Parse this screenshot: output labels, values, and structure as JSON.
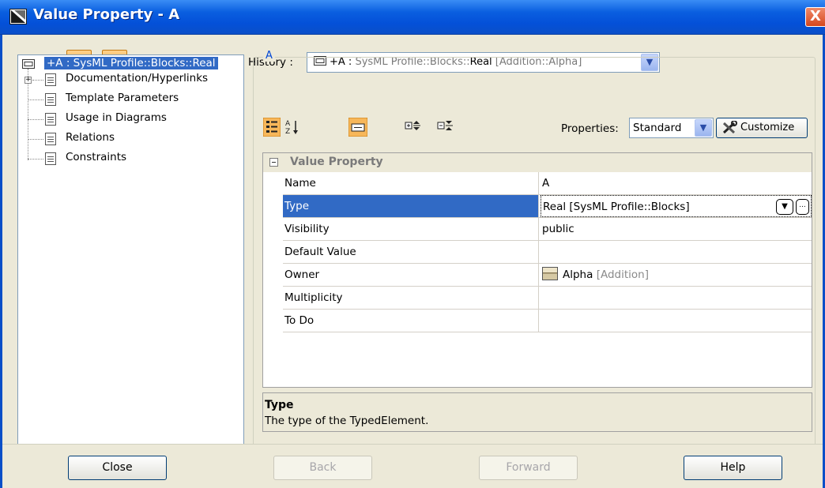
{
  "window": {
    "title": "Value Property - A",
    "close_glyph": "X"
  },
  "toolbar": {
    "history_label": "History :",
    "history_value_prefix": "+A : ",
    "history_value_path": "SysML Profile::Blocks::",
    "history_value_name": "Real",
    "history_value_ctx": " [Addition::Alpha]"
  },
  "tree": {
    "root_label": "+A : SysML Profile::Blocks::Real",
    "items": [
      {
        "label": "Documentation/Hyperlinks"
      },
      {
        "label": "Template Parameters"
      },
      {
        "label": "Usage in Diagrams"
      },
      {
        "label": "Relations"
      },
      {
        "label": "Constraints"
      }
    ]
  },
  "group": {
    "title": "A"
  },
  "properties_toolbar": {
    "label": "Properties:",
    "selected": "Standard",
    "customize_label": "Customize"
  },
  "ptable": {
    "section": "Value Property",
    "rows": [
      {
        "name": "Name",
        "value": "A"
      },
      {
        "name": "Type",
        "value": "Real [SysML Profile::Blocks]"
      },
      {
        "name": "Visibility",
        "value": "public"
      },
      {
        "name": "Default Value",
        "value": ""
      },
      {
        "name": "Owner",
        "value": "Alpha",
        "value_extra": "[Addition]"
      },
      {
        "name": "Multiplicity",
        "value": ""
      },
      {
        "name": "To Do",
        "value": ""
      }
    ]
  },
  "description": {
    "title": "Type",
    "text": "The type of the TypedElement."
  },
  "buttons": {
    "close": "Close",
    "back": "Back",
    "forward": "Forward",
    "help": "Help"
  },
  "colors": {
    "titlebar": "#0a5fe0",
    "selection": "#316ac5",
    "accent_orange": "#f5a43b",
    "group_title": "#0046d5"
  }
}
